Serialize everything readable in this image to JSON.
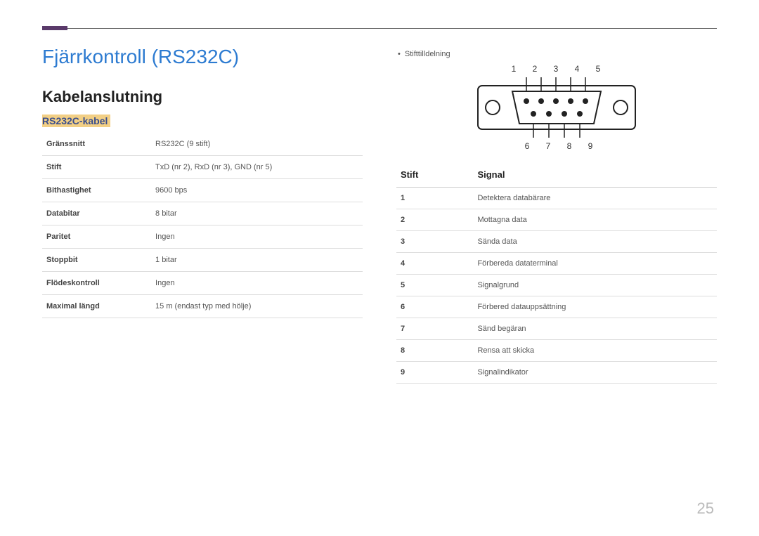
{
  "title": "Fjärrkontroll (RS232C)",
  "section": "Kabelanslutning",
  "subsection": "RS232C-kabel",
  "specs": [
    {
      "k": "Gränssnitt",
      "v": "RS232C (9 stift)"
    },
    {
      "k": "Stift",
      "v": "TxD (nr 2), RxD (nr 3), GND (nr 5)"
    },
    {
      "k": "Bithastighet",
      "v": "9600 bps"
    },
    {
      "k": "Databitar",
      "v": "8 bitar"
    },
    {
      "k": "Paritet",
      "v": "Ingen"
    },
    {
      "k": "Stoppbit",
      "v": "1 bitar"
    },
    {
      "k": "Flödeskontroll",
      "v": "Ingen"
    },
    {
      "k": "Maximal längd",
      "v": "15 m (endast typ med hölje)"
    }
  ],
  "pin_assignment_label": "Stifttilldelning",
  "top_pins": "1 2 3 4 5",
  "bottom_pins": "6 7 8 9",
  "pin_table": {
    "head_pin": "Stift",
    "head_signal": "Signal",
    "rows": [
      {
        "n": "1",
        "s": "Detektera databärare"
      },
      {
        "n": "2",
        "s": "Mottagna data"
      },
      {
        "n": "3",
        "s": "Sända data"
      },
      {
        "n": "4",
        "s": "Förbereda dataterminal"
      },
      {
        "n": "5",
        "s": "Signalgrund"
      },
      {
        "n": "6",
        "s": "Förbered datauppsättning"
      },
      {
        "n": "7",
        "s": "Sänd begäran"
      },
      {
        "n": "8",
        "s": "Rensa att skicka"
      },
      {
        "n": "9",
        "s": "Signalindikator"
      }
    ]
  },
  "page_number": "25"
}
